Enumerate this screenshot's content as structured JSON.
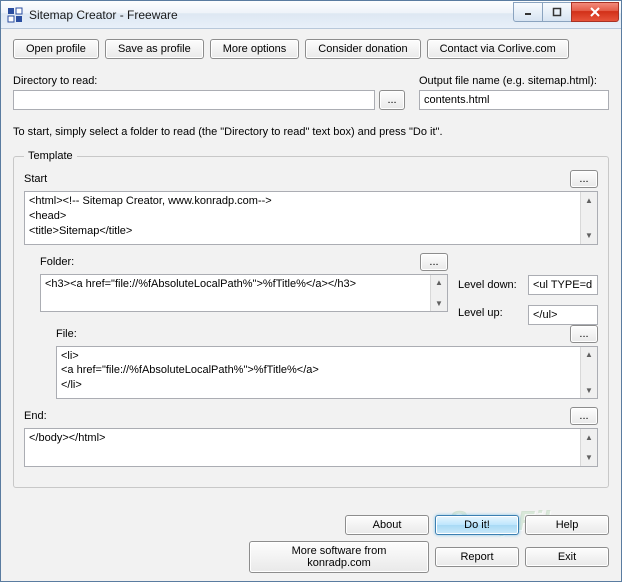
{
  "title": "Sitemap Creator - Freeware",
  "toolbar": {
    "open_profile": "Open profile",
    "save_profile": "Save as profile",
    "more_options": "More options",
    "consider_donation": "Consider donation",
    "contact": "Contact via Corlive.com"
  },
  "dir": {
    "label": "Directory to read:",
    "value": ""
  },
  "output": {
    "label": "Output file name (e.g. sitemap.html):",
    "value": "contents.html"
  },
  "instruction": "To start, simply select a folder to read (the \"Directory to read\" text box) and press \"Do it\".",
  "template": {
    "legend": "Template",
    "start": {
      "label": "Start",
      "text": "<html><!-- Sitemap Creator, www.konradp.com-->\n<head>\n<title>Sitemap</title>"
    },
    "folder": {
      "label": "Folder:",
      "text": "<h3><a href=\"file://%fAbsoluteLocalPath%\">%fTitle%</a></h3>"
    },
    "level_down": {
      "label": "Level down:",
      "value": "<ul TYPE=d"
    },
    "level_up": {
      "label": "Level up:",
      "value": "</ul>"
    },
    "file": {
      "label": "File:",
      "text": "<li>\n<a href=\"file://%fAbsoluteLocalPath%\">%fTitle%</a>\n</li>"
    },
    "end": {
      "label": "End:",
      "text": "</body></html>"
    }
  },
  "buttons": {
    "about": "About",
    "doit": "Do it!",
    "help": "Help",
    "more_software": "More software from konradp.com",
    "report": "Report",
    "exit": "Exit"
  },
  "browse": "...",
  "watermark": "SnapFiles"
}
